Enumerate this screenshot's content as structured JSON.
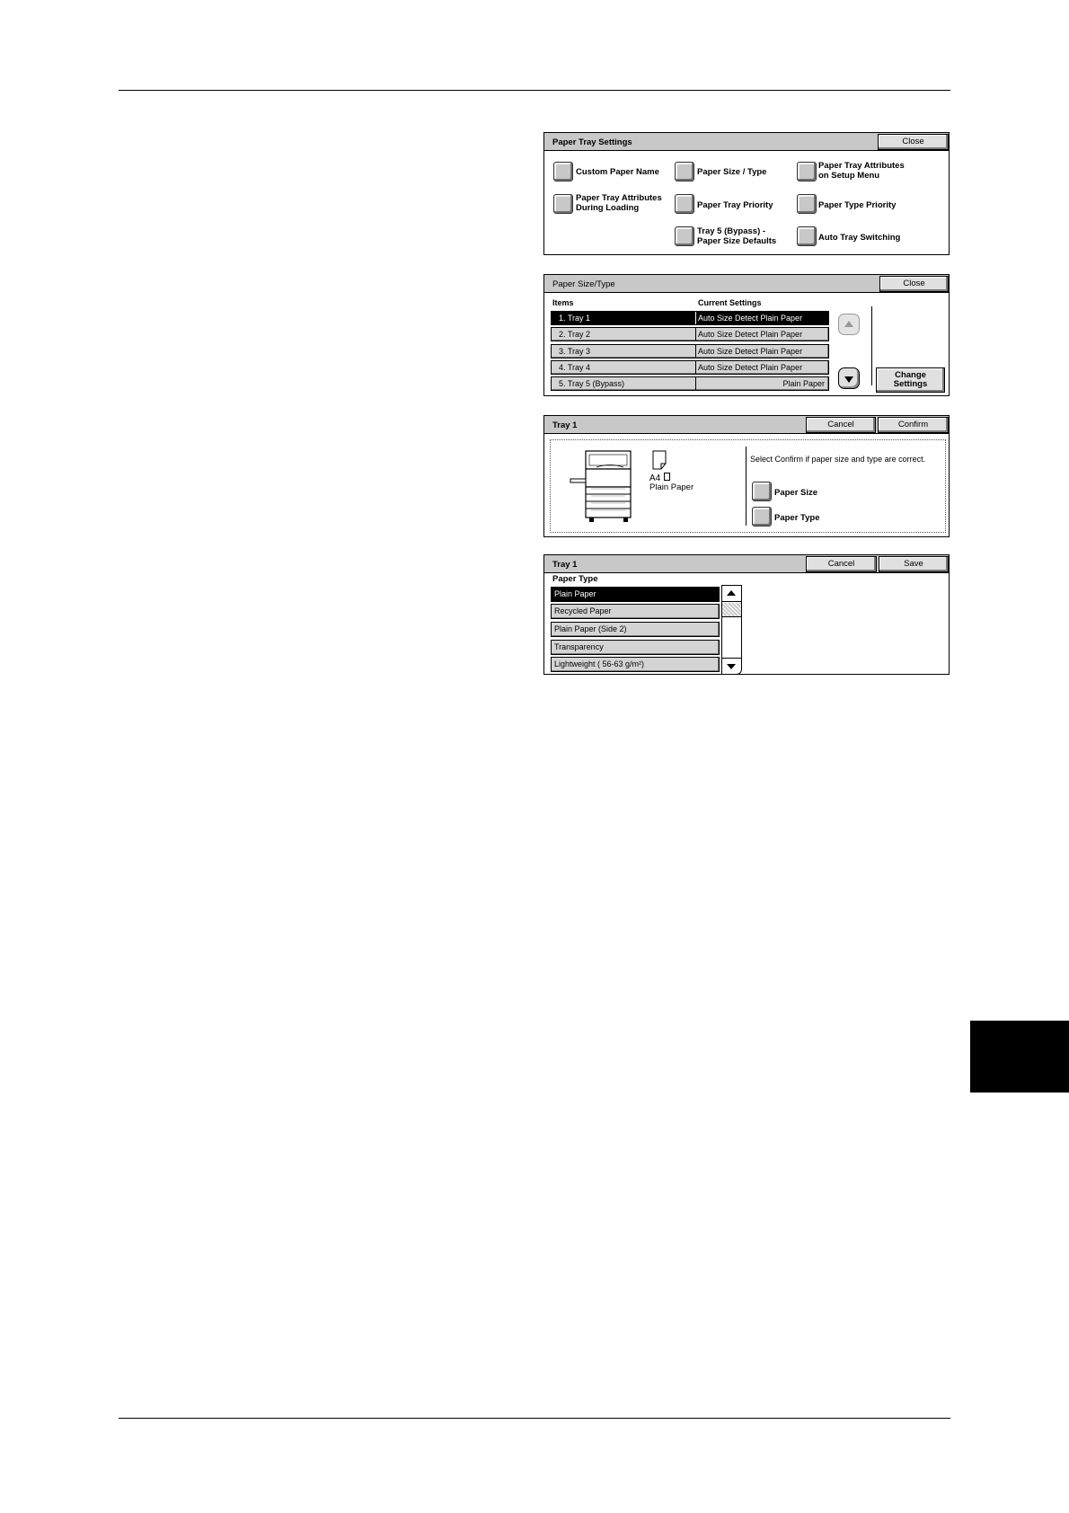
{
  "panel1": {
    "title": "Paper Tray Settings",
    "close": "Close",
    "buttons": [
      "Custom Paper Name",
      "Paper Size / Type",
      "Paper Tray Attributes\non Setup Menu",
      "Paper Tray Attributes\nDuring Loading",
      "Paper Tray Priority",
      "Paper Type Priority",
      "Tray 5 (Bypass) -\nPaper Size Defaults",
      "Auto Tray Switching"
    ]
  },
  "panel2": {
    "title": "Paper Size/Type",
    "close": "Close",
    "col_items": "Items",
    "col_current": "Current Settings",
    "rows": [
      {
        "item": "1. Tray 1",
        "setting": "Auto Size Detect  Plain Paper"
      },
      {
        "item": "2. Tray 2",
        "setting": "Auto Size Detect  Plain Paper"
      },
      {
        "item": "3. Tray 3",
        "setting": "Auto Size Detect  Plain Paper"
      },
      {
        "item": "4. Tray 4",
        "setting": "Auto Size Detect  Plain Paper"
      },
      {
        "item": "5. Tray 5 (Bypass)",
        "setting": "Plain Paper"
      }
    ],
    "change": "Change\nSettings"
  },
  "panel3": {
    "title": "Tray 1",
    "cancel": "Cancel",
    "confirm": "Confirm",
    "paper_size": "A4",
    "paper_type": "Plain Paper",
    "message": "Select Confirm if paper size and type are correct.",
    "btn_size": "Paper Size",
    "btn_type": "Paper Type"
  },
  "panel4": {
    "title": "Tray 1",
    "cancel": "Cancel",
    "save": "Save",
    "subtitle": "Paper Type",
    "items": [
      "Plain Paper",
      "Recycled Paper",
      "Plain Paper (Side 2)",
      "Transparency",
      "Lightweight ( 56-63 g/m²)"
    ]
  }
}
